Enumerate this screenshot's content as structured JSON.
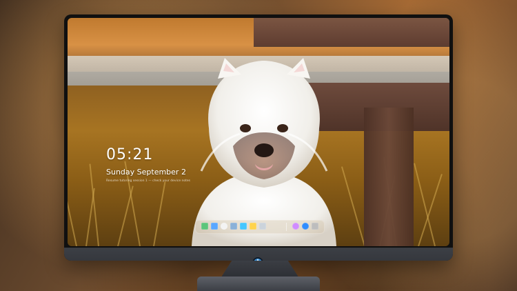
{
  "lockscreen": {
    "time": "05:21",
    "date": "Sunday September 2",
    "hint": "Resume tutoring session 1 — check your device notes"
  },
  "dock": {
    "items": [
      {
        "name": "messages-icon",
        "color": "#5cc57a"
      },
      {
        "name": "finder-icon",
        "color": "#5aa7ff"
      },
      {
        "name": "clock-icon",
        "color": "#f3f3f3"
      },
      {
        "name": "preview-icon",
        "color": "#8ab1d8"
      },
      {
        "name": "files-icon",
        "color": "#44c6ff"
      },
      {
        "name": "notes-icon",
        "color": "#ffd34d"
      },
      {
        "name": "photos-icon",
        "color": "#cbd3db"
      },
      {
        "name": "music-icon",
        "color": "#d08cff"
      },
      {
        "name": "appstore-icon",
        "color": "#2f8dff"
      },
      {
        "name": "camera-icon",
        "color": "#bdbdbd"
      }
    ]
  },
  "brand": {
    "logo": "monitor-brand-logo",
    "accent": "#7cc6ff"
  }
}
